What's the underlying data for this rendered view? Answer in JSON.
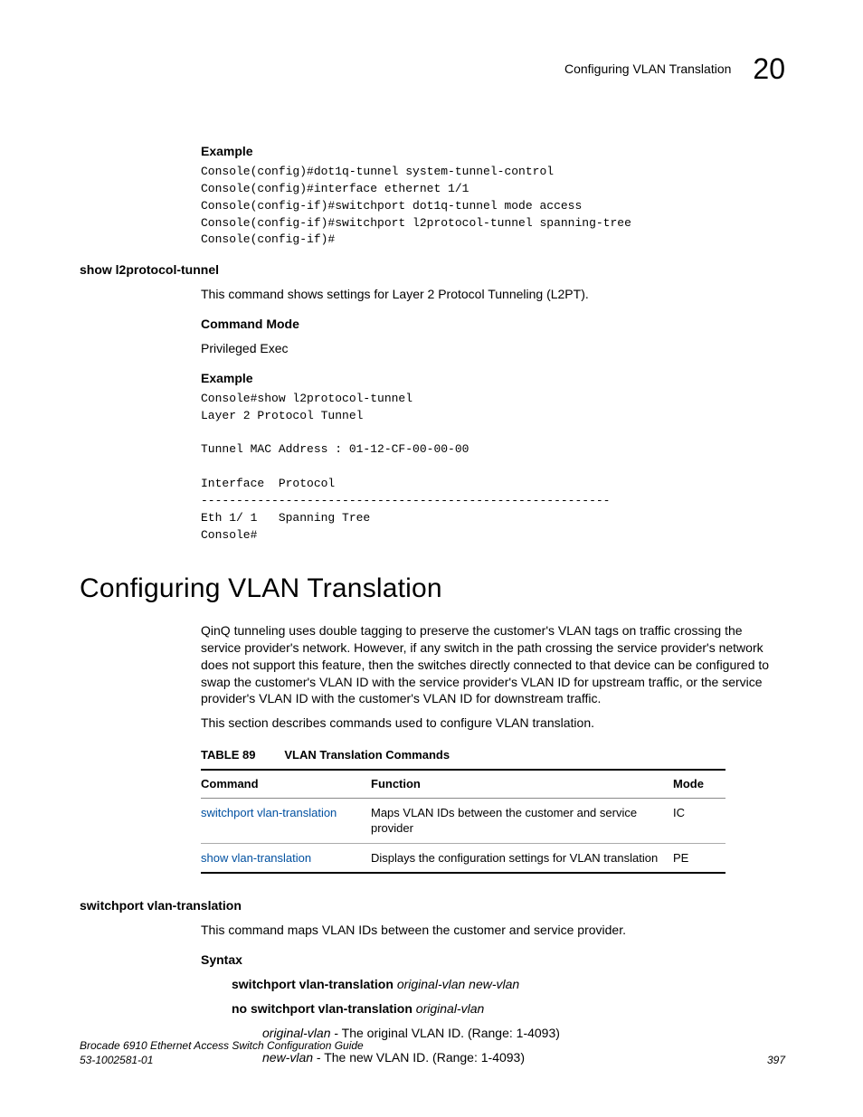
{
  "running_head": {
    "title": "Configuring VLAN Translation",
    "chapter": "20"
  },
  "section1": {
    "example_head": "Example",
    "example_code": "Console(config)#dot1q-tunnel system-tunnel-control\nConsole(config)#interface ethernet 1/1\nConsole(config-if)#switchport dot1q-tunnel mode access\nConsole(config-if)#switchport l2protocol-tunnel spanning-tree\nConsole(config-if)#"
  },
  "cmd1": {
    "name": "show l2protocol-tunnel",
    "desc": "This command shows settings for Layer 2 Protocol Tunneling (L2PT).",
    "mode_head": "Command Mode",
    "mode_val": "Privileged Exec",
    "example_head": "Example",
    "example_code": "Console#show l2protocol-tunnel\nLayer 2 Protocol Tunnel\n\nTunnel MAC Address : 01-12-CF-00-00-00\n\nInterface  Protocol\n----------------------------------------------------------\nEth 1/ 1   Spanning Tree\nConsole#"
  },
  "h1": "Configuring VLAN Translation",
  "intro_para": "QinQ tunneling uses double tagging to preserve the customer's VLAN tags on traffic crossing the service provider's network. However, if any switch in the path crossing the service provider's network does not support this feature, then the switches directly connected to that device can be configured to swap the customer's VLAN ID with the service provider's VLAN ID for upstream traffic, or the service provider's VLAN ID with the customer's VLAN ID for downstream traffic.",
  "intro_para2": "This section describes commands used to configure VLAN translation.",
  "table": {
    "label": "TABLE 89",
    "title": "VLAN Translation Commands",
    "headers": {
      "c1": "Command",
      "c2": "Function",
      "c3": "Mode"
    },
    "rows": [
      {
        "cmd": "switchport vlan-translation",
        "func": "Maps VLAN IDs between the customer and service provider",
        "mode": "IC"
      },
      {
        "cmd": "show vlan-translation",
        "func": "Displays the configuration settings for VLAN translation",
        "mode": "PE"
      }
    ]
  },
  "cmd2": {
    "name": "switchport vlan-translation",
    "desc": "This command maps VLAN IDs between the customer and service provider.",
    "syntax_head": "Syntax",
    "syntax_line1_bold": "switchport vlan-translation",
    "syntax_line1_ital": "original-vlan new-vlan",
    "syntax_line2_bold": "no switchport vlan-translation",
    "syntax_line2_ital": "original-vlan",
    "param1_name": "original-vlan",
    "param1_desc": " - The original VLAN ID. (Range: 1-4093)",
    "param2_name": "new-vlan",
    "param2_desc": " - The new VLAN ID. (Range: 1-4093)"
  },
  "footer": {
    "left_line1": "Brocade 6910 Ethernet Access Switch Configuration Guide",
    "left_line2": "53-1002581-01",
    "page": "397"
  }
}
